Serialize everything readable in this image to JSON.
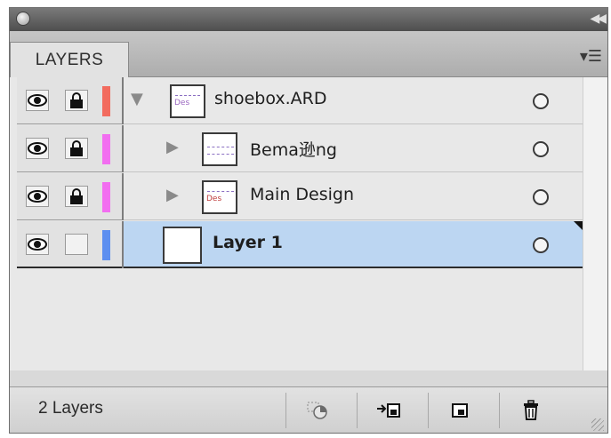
{
  "panel": {
    "tab_label": "LAYERS",
    "menu_icon": "panel-menu-icon",
    "collapse_icon": "collapse-arrows-icon"
  },
  "layers": [
    {
      "name": "shoebox.ARD",
      "expanded": true,
      "indent": 0,
      "color": "#f26b5e",
      "visible": true,
      "locked": true,
      "selected": false
    },
    {
      "name": "Bema逊n g",
      "display": "Bema逊ng",
      "expanded": false,
      "indent": 1,
      "color": "#f26ef0",
      "visible": true,
      "locked": true,
      "selected": false
    },
    {
      "name": "Main Design",
      "expanded": false,
      "indent": 1,
      "color": "#f26ef0",
      "visible": true,
      "locked": true,
      "selected": false
    },
    {
      "name": "Layer 1",
      "expanded": null,
      "indent": 0,
      "color": "#5d8ff0",
      "visible": true,
      "locked": false,
      "selected": true
    }
  ],
  "footer": {
    "layer_count": "2 Layers",
    "buttons": [
      "locate-object-icon",
      "make-clipping-mask-icon",
      "new-layer-icon",
      "trash-icon"
    ]
  }
}
